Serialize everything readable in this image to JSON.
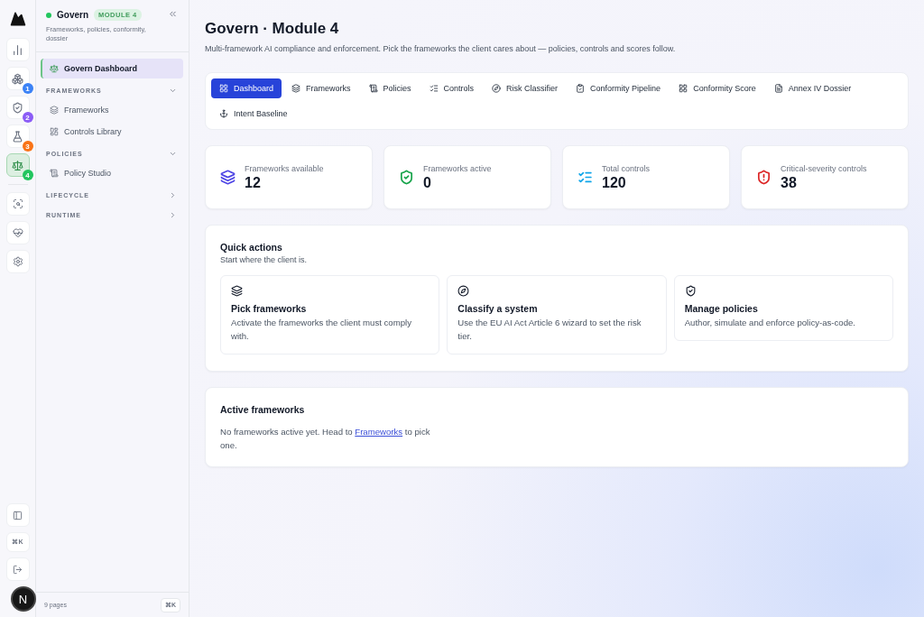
{
  "rail": {
    "items": [
      {
        "selected": false
      },
      {
        "badge": "1",
        "color": "#3b82f6",
        "selected": false
      },
      {
        "badge": "2",
        "color": "#8b5cf6",
        "selected": false
      },
      {
        "badge": "3",
        "color": "#f97316",
        "selected": false
      },
      {
        "badge": "4",
        "color": "#22c55e",
        "selected": true
      }
    ],
    "bottom_keys": "⌘K",
    "avatar": "N"
  },
  "sidebar": {
    "title": "Govern",
    "online": true,
    "badge": "MODULE 4",
    "subtitle": "Frameworks, policies, conformity, dossier",
    "items": [
      {
        "kind": "link",
        "label": "Govern Dashboard",
        "selected": true
      },
      {
        "kind": "section",
        "label": "FRAMEWORKS",
        "expanded": true
      },
      {
        "kind": "link",
        "label": "Frameworks",
        "selected": false
      },
      {
        "kind": "link",
        "label": "Controls Library",
        "selected": false
      },
      {
        "kind": "section",
        "label": "POLICIES",
        "expanded": true
      },
      {
        "kind": "link",
        "label": "Policy Studio",
        "selected": false
      },
      {
        "kind": "section",
        "label": "LIFECYCLE",
        "expanded": false
      },
      {
        "kind": "section",
        "label": "RUNTIME",
        "expanded": false
      }
    ],
    "footer": "9 pages",
    "footer_keys": "⌘K"
  },
  "page": {
    "title": "Govern · Module 4",
    "subtitle": "Multi-framework AI compliance and enforcement. Pick the frameworks the client cares about — policies, controls and scores follow."
  },
  "tabs": [
    {
      "label": "Dashboard",
      "selected": true
    },
    {
      "label": "Frameworks",
      "selected": false
    },
    {
      "label": "Policies",
      "selected": false
    },
    {
      "label": "Controls",
      "selected": false
    },
    {
      "label": "Risk Classifier",
      "selected": false
    },
    {
      "label": "Conformity Pipeline",
      "selected": false
    },
    {
      "label": "Conformity Score",
      "selected": false
    },
    {
      "label": "Annex IV Dossier",
      "selected": false
    },
    {
      "label": "Intent Baseline",
      "selected": false
    }
  ],
  "stats": [
    {
      "label": "Frameworks available",
      "value": "12",
      "color": "#4f46e5"
    },
    {
      "label": "Frameworks active",
      "value": "0",
      "color": "#16a34a"
    },
    {
      "label": "Total controls",
      "value": "120",
      "color": "#0ea5e9"
    },
    {
      "label": "Critical-severity controls",
      "value": "38",
      "color": "#dc2626"
    }
  ],
  "quick_actions": {
    "title": "Quick actions",
    "subtitle": "Start where the client is.",
    "cards": [
      {
        "title": "Pick frameworks",
        "text": "Activate the frameworks the client must comply with."
      },
      {
        "title": "Classify a system",
        "text": "Use the EU AI Act Article 6 wizard to set the risk tier."
      },
      {
        "title": "Manage policies",
        "text": "Author, simulate and enforce policy-as-code."
      }
    ]
  },
  "active_frameworks": {
    "title": "Active frameworks",
    "text_before": "No frameworks active yet. Head to",
    "link": "Frameworks",
    "text_after": "to pick one."
  }
}
